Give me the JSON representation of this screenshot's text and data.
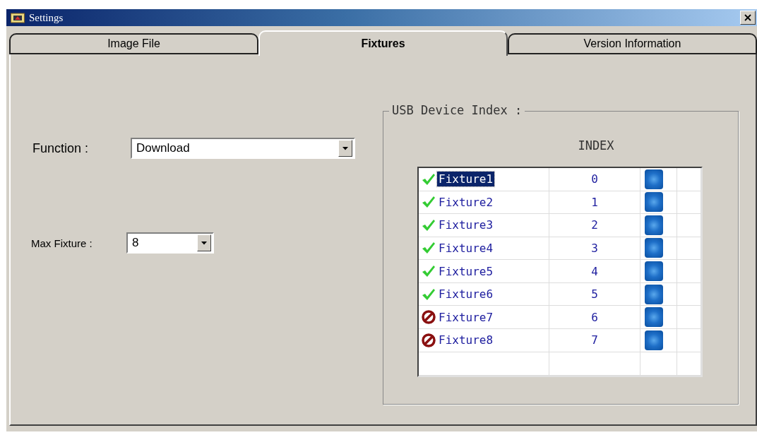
{
  "window": {
    "title": "Settings"
  },
  "tabs": [
    {
      "label": "Image File",
      "selected": false
    },
    {
      "label": "Fixtures",
      "selected": true
    },
    {
      "label": "Version Information",
      "selected": false
    }
  ],
  "function": {
    "label": "Function :",
    "value": "Download"
  },
  "max_fixture": {
    "label": "Max Fixture :",
    "value": "8"
  },
  "usb_group": {
    "title": "USB Device Index :",
    "header": "INDEX",
    "rows": [
      {
        "name": "Fixture1",
        "index": "0",
        "kind": "ok",
        "selected": true
      },
      {
        "name": "Fixture2",
        "index": "1",
        "kind": "ok",
        "selected": false
      },
      {
        "name": "Fixture3",
        "index": "2",
        "kind": "ok",
        "selected": false
      },
      {
        "name": "Fixture4",
        "index": "3",
        "kind": "ok",
        "selected": false
      },
      {
        "name": "Fixture5",
        "index": "4",
        "kind": "ok",
        "selected": false
      },
      {
        "name": "Fixture6",
        "index": "5",
        "kind": "ok",
        "selected": false
      },
      {
        "name": "Fixture7",
        "index": "6",
        "kind": "blocked",
        "selected": false
      },
      {
        "name": "Fixture8",
        "index": "7",
        "kind": "blocked",
        "selected": false
      }
    ]
  }
}
